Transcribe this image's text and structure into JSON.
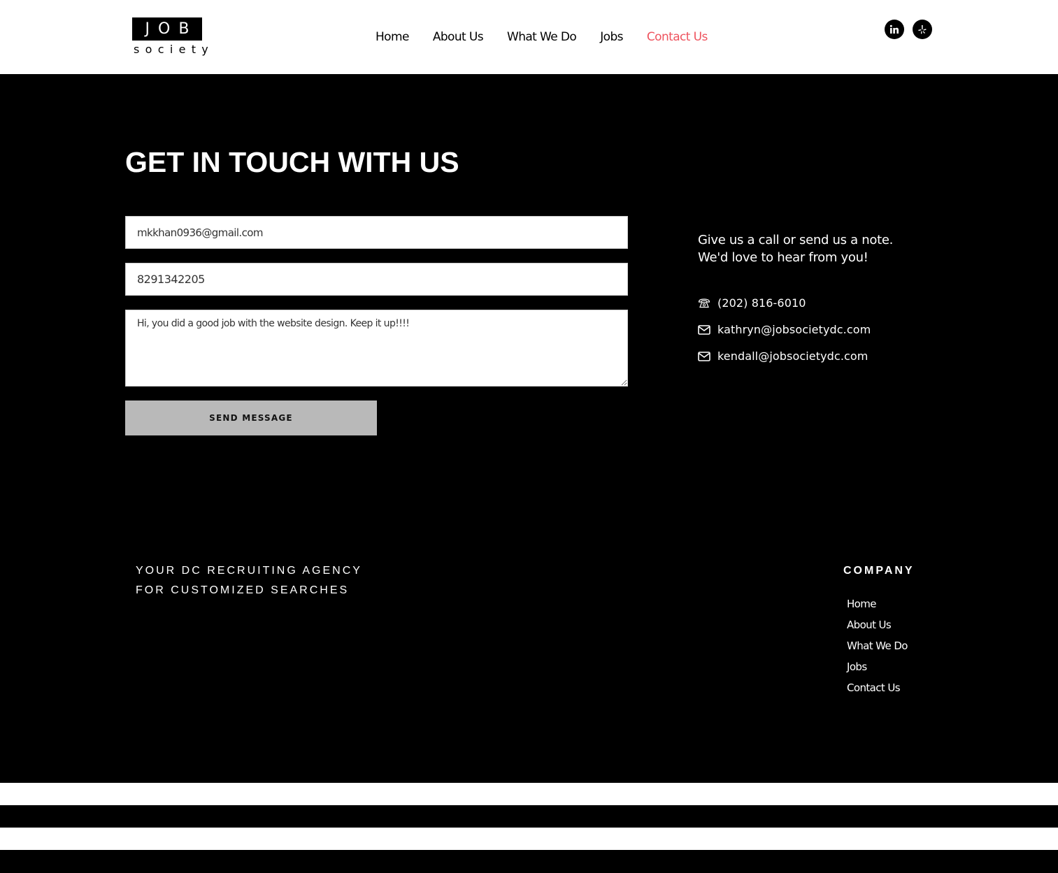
{
  "logo": {
    "top": "JOB",
    "bottom": "society"
  },
  "nav": [
    {
      "label": "Home"
    },
    {
      "label": "About Us"
    },
    {
      "label": "What We Do"
    },
    {
      "label": "Jobs"
    },
    {
      "label": "Contact Us",
      "active": true
    }
  ],
  "social": [
    {
      "icon": "linkedin-icon"
    },
    {
      "icon": "yelp-icon"
    }
  ],
  "contact": {
    "title": "GET IN TOUCH WITH US",
    "form": {
      "email_value": "mkkhan0936@gmail.com",
      "phone_value": "8291342205",
      "message_value": "Hi, you did a good job with the website design. Keep it up!!!!",
      "send_label": "SEND MESSAGE"
    },
    "info_line1": "Give us a call or send us a note.",
    "info_line2": "We'd love to hear from you!",
    "phone": "(202) 816-6010",
    "email1": "kathryn@jobsocietydc.com",
    "email2": "kendall@jobsocietydc.com"
  },
  "footer": {
    "tagline1": "YOUR DC RECRUITING AGENCY",
    "tagline2": "FOR CUSTOMIZED SEARCHES",
    "company_heading": "COMPANY",
    "links": [
      "Home",
      "About Us",
      "What We Do",
      "Jobs",
      "Contact Us"
    ]
  },
  "colors": {
    "accent": "#ee535e",
    "button": "#b9b9b9",
    "background": "#000000"
  }
}
